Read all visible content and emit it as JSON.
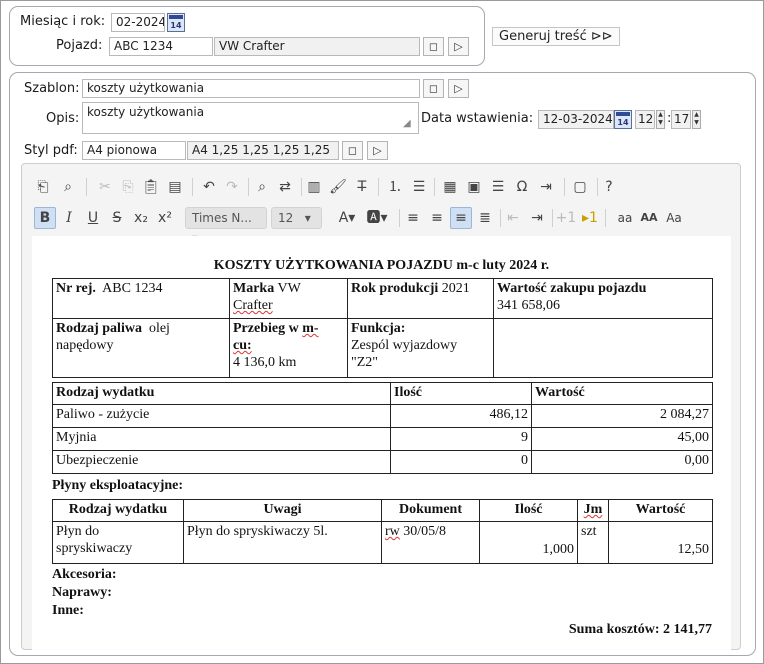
{
  "top": {
    "month_label": "Miesiąc i rok:",
    "month_value": "02-2024",
    "vehicle_label": "Pojazd:",
    "vehicle_code": "ABC 1234",
    "vehicle_name": "VW Crafter",
    "generate_label": "Generuj treść"
  },
  "calendar_day": "14",
  "form": {
    "template_label": "Szablon:",
    "template_value": "koszty użytkowania",
    "description_label": "Opis:",
    "description_value": "koszty użytkowania",
    "insert_date_label": "Data wstawienia:",
    "insert_date_value": "12-03-2024",
    "insert_hour": "12",
    "insert_minute": "17",
    "pdf_style_label": "Styl pdf:",
    "pdf_style_value": "A4 pionowa",
    "pdf_margins": "A4 1,25 1,25 1,25 1,25"
  },
  "toolbar": {
    "font_name": "Times N...",
    "font_size": "12"
  },
  "document": {
    "title": "KOSZTY UŻYTKOWANIA POJAZDU m-c luty 2024 r.",
    "info": {
      "reg_label": "Nr rej.",
      "reg_value": "ABC 1234",
      "make_label": "Marka",
      "make_value_1": "VW",
      "make_value_2": "Crafter",
      "year_label": "Rok produkcji",
      "year_value": "2021",
      "purchase_label": "Wartość zakupu pojazdu",
      "purchase_value": "341 658,06",
      "fuel_label": "Rodzaj paliwa",
      "fuel_value_1": "olej",
      "fuel_value_2": "napędowy",
      "mileage_label_1": "Przebieg w",
      "mileage_label_2": "m-",
      "mileage_label_3": "cu:",
      "mileage_value": "4 136,0 km",
      "function_label": "Funkcja:",
      "function_value_1": "Zespól wyjazdowy",
      "function_value_2": "\"Z2\""
    },
    "expenses": {
      "headers": [
        "Rodzaj wydatku",
        "Ilość",
        "Wartość"
      ],
      "rows": [
        [
          "Paliwo - zużycie",
          "486,12",
          "2 084,27"
        ],
        [
          "Myjnia",
          "9",
          "45,00"
        ],
        [
          "Ubezpieczenie",
          "0",
          "0,00"
        ]
      ]
    },
    "fluids_label": "Płyny eksploatacyjne:",
    "fluids": {
      "headers": [
        "Rodzaj wydatku",
        "Uwagi",
        "Dokument",
        "Ilość",
        "Jm",
        "Wartość"
      ],
      "row": {
        "type_1": "Płyn do",
        "type_2": "spryskiwaczy",
        "note": "Płyn do spryskiwaczy 5l.",
        "doc_prefix": "rw",
        "doc_rest": "30/05/8",
        "qty": "1,000",
        "unit": "szt",
        "value": "12,50"
      }
    },
    "accessories_label": "Akcesoria:",
    "repairs_label": "Naprawy:",
    "other_label": "Inne:",
    "total": "Suma kosztów: 2 141,77"
  }
}
